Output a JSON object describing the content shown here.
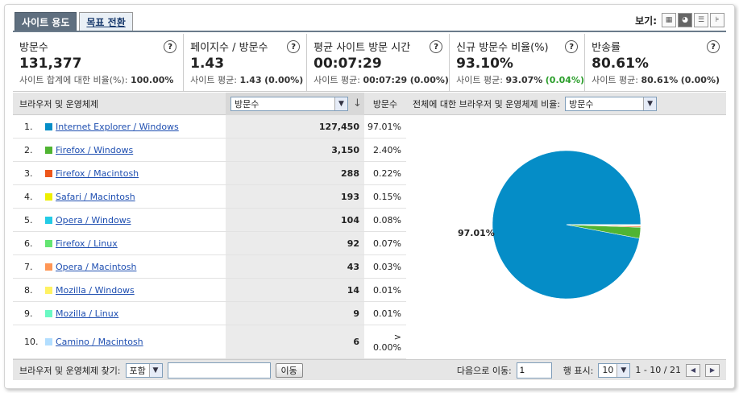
{
  "tabs": [
    {
      "label": "사이트 용도"
    },
    {
      "label": "목표 전환"
    }
  ],
  "view": {
    "label": "보기:"
  },
  "metrics": [
    {
      "title": "방문수",
      "value": "131,377",
      "sub_label": "사이트 합계에 대한 비율(%):",
      "sub_value": "100.00%",
      "sub_extra": ""
    },
    {
      "title": "페이지수 / 방문수",
      "value": "1.43",
      "sub_label": "사이트 평균:",
      "sub_value": "1.43",
      "sub_extra": "(0.00%)"
    },
    {
      "title": "평균 사이트 방문 시간",
      "value": "00:07:29",
      "sub_label": "사이트 평균:",
      "sub_value": "00:07:29",
      "sub_extra": "(0.00%)"
    },
    {
      "title": "신규 방문수 비율(%)",
      "value": "93.10%",
      "sub_label": "사이트 평균:",
      "sub_value": "93.07%",
      "sub_extra": "(0.04%)"
    },
    {
      "title": "반송률",
      "value": "80.61%",
      "sub_label": "사이트 평균:",
      "sub_value": "80.61%",
      "sub_extra": "(0.00%)"
    }
  ],
  "help_glyph": "?",
  "table": {
    "dimension_header": "브라우저 및 운영체제",
    "metric_select": "방문수",
    "pct_header": "방문수",
    "pie_label": "전체에 대한 브라우저 및 운영체제 비율:",
    "pie_select": "방문수",
    "rows": [
      {
        "num": "1.",
        "name": "Internet Explorer / Windows",
        "value": "127,450",
        "pct": "97.01%",
        "color": "#058dc7"
      },
      {
        "num": "2.",
        "name": "Firefox / Windows",
        "value": "3,150",
        "pct": "2.40%",
        "color": "#50b432"
      },
      {
        "num": "3.",
        "name": "Firefox / Macintosh",
        "value": "288",
        "pct": "0.22%",
        "color": "#ed561b"
      },
      {
        "num": "4.",
        "name": "Safari / Macintosh",
        "value": "193",
        "pct": "0.15%",
        "color": "#edef00"
      },
      {
        "num": "5.",
        "name": "Opera / Windows",
        "value": "104",
        "pct": "0.08%",
        "color": "#24cbe5"
      },
      {
        "num": "6.",
        "name": "Firefox / Linux",
        "value": "92",
        "pct": "0.07%",
        "color": "#64e572"
      },
      {
        "num": "7.",
        "name": "Opera / Macintosh",
        "value": "43",
        "pct": "0.03%",
        "color": "#ff9655"
      },
      {
        "num": "8.",
        "name": "Mozilla / Windows",
        "value": "14",
        "pct": "0.01%",
        "color": "#fff263"
      },
      {
        "num": "9.",
        "name": "Mozilla / Linux",
        "value": "9",
        "pct": "0.01%",
        "color": "#6af9c4"
      },
      {
        "num": "10.",
        "name": "Camino / Macintosh",
        "value": "6",
        "pct": "> 0.00%",
        "color": "#b2deff"
      }
    ]
  },
  "chart_data": {
    "type": "pie",
    "categories": [
      "Internet Explorer / Windows",
      "Firefox / Windows",
      "Firefox / Macintosh",
      "Safari / Macintosh",
      "Opera / Windows",
      "Firefox / Linux",
      "Opera / Macintosh",
      "Mozilla / Windows",
      "Mozilla / Linux",
      "Camino / Macintosh"
    ],
    "values": [
      127450,
      3150,
      288,
      193,
      104,
      92,
      43,
      14,
      9,
      6
    ],
    "colors": [
      "#058dc7",
      "#50b432",
      "#ed561b",
      "#edef00",
      "#24cbe5",
      "#64e572",
      "#ff9655",
      "#fff263",
      "#6af9c4",
      "#b2deff"
    ],
    "slice_label": "97.01%"
  },
  "footer": {
    "find_label": "브라우저 및 운영체제 찾기:",
    "match_select": "포함",
    "search_value": "",
    "go_button": "이동",
    "goto_label": "다음으로 이동:",
    "goto_value": "1",
    "rows_label": "행 표시:",
    "rows_select": "10",
    "range": "1 - 10 / 21",
    "prev_glyph": "◀",
    "next_glyph": "▶"
  }
}
